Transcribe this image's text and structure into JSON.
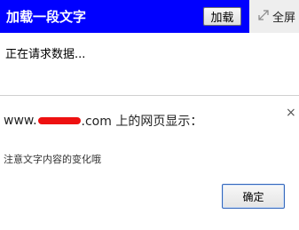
{
  "header": {
    "title": "加载一段文字",
    "load_button_label": "加载",
    "fullscreen_label": "全屏"
  },
  "content": {
    "status_text": "正在请求数据..."
  },
  "dialog": {
    "title_prefix": "www.",
    "title_suffix": ".com 上的网页显示：",
    "message": "注意文字内容的变化哦",
    "close_symbol": "×",
    "ok_label": "确定"
  },
  "colors": {
    "header_bg": "#0000ff",
    "redaction": "#ee1111"
  }
}
